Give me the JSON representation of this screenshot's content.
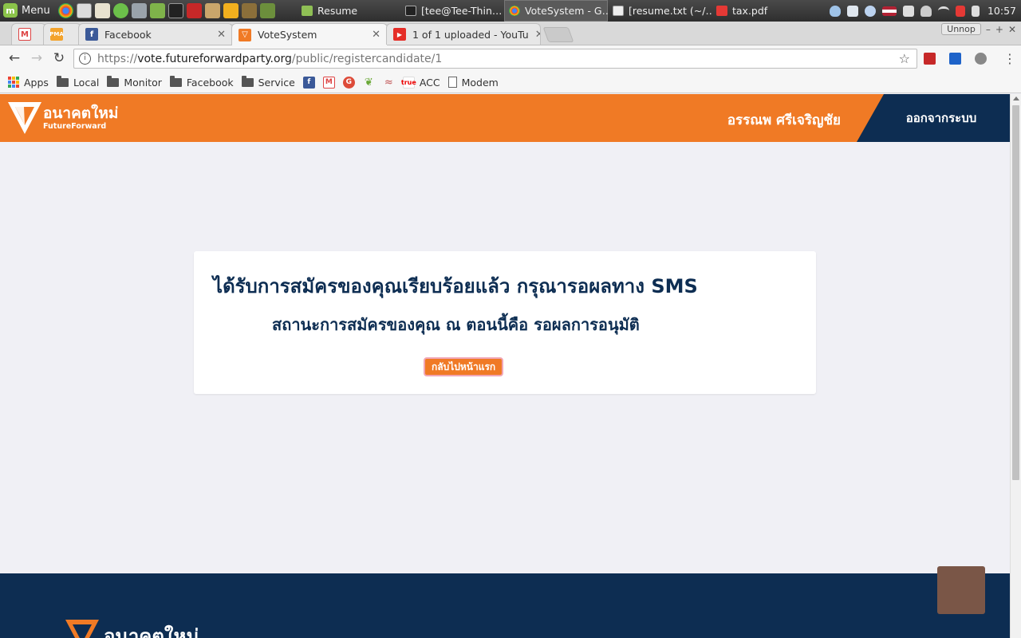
{
  "taskbar": {
    "menu_label": "Menu",
    "tasks": [
      {
        "label": "Resume",
        "icon": "folder-icon",
        "active": false
      },
      {
        "label": "[tee@Tee-Thin…",
        "icon": "terminal-icon",
        "active": false
      },
      {
        "label": "VoteSystem - G…",
        "icon": "chrome-icon",
        "active": true
      },
      {
        "label": "[resume.txt (~/…",
        "icon": "text-editor-icon",
        "active": false
      },
      {
        "label": "tax.pdf",
        "icon": "pdf-icon",
        "active": false
      }
    ],
    "clock": "10:57"
  },
  "browser": {
    "tabs": [
      {
        "label": "",
        "favicon": "gmail-icon",
        "active": false
      },
      {
        "label": "",
        "favicon": "pma-icon",
        "favicon_text": "PMA",
        "active": false
      },
      {
        "label": "Facebook",
        "favicon": "facebook-icon",
        "active": false
      },
      {
        "label": "VoteSystem",
        "favicon": "futureforward-icon",
        "active": true
      },
      {
        "label": "1 of 1 uploaded - YouTu",
        "favicon": "youtube-icon",
        "active": false
      }
    ],
    "profile_label": "Unnop",
    "url": {
      "scheme": "https://",
      "host": "vote.futureforwardparty.org",
      "path": "/public/registercandidate/1"
    },
    "bookmarks": [
      {
        "label": "Apps",
        "icon": "apps-grid-icon"
      },
      {
        "label": "Local",
        "icon": "folder-icon"
      },
      {
        "label": "Monitor",
        "icon": "folder-icon"
      },
      {
        "label": "Facebook",
        "icon": "folder-icon"
      },
      {
        "label": "Service",
        "icon": "folder-icon"
      },
      {
        "label": "",
        "icon": "facebook-icon"
      },
      {
        "label": "",
        "icon": "gmail-icon"
      },
      {
        "label": "",
        "icon": "google-plus-icon"
      },
      {
        "label": "",
        "icon": "sprout-icon"
      },
      {
        "label": "",
        "icon": "feather-icon"
      },
      {
        "label": "ACC",
        "icon": "true-icon",
        "icon_text": "true"
      },
      {
        "label": "Modem",
        "icon": "page-icon"
      }
    ]
  },
  "site": {
    "logo_th": "อนาคตใหม่",
    "logo_en": "FutureForward",
    "username": "อรรณพ ศรีเจริญชัย",
    "logout_label": "ออกจากระบบ",
    "card": {
      "title": "ได้รับการสมัครของคุณเรียบร้อยแล้ว กรุณารอผลทาง SMS",
      "status": "สถานะการสมัครของคุณ ณ ตอนนี้คือ รอผลการอนุมัติ",
      "back_button": "กลับไปหน้าแรก"
    },
    "footer_logo_th": "อนาคตใหม่"
  },
  "colors": {
    "brand_orange": "#f07a25",
    "brand_navy": "#0d2d52",
    "page_bg": "#f0f0f5",
    "scroll_top_button": "#7a5647"
  }
}
